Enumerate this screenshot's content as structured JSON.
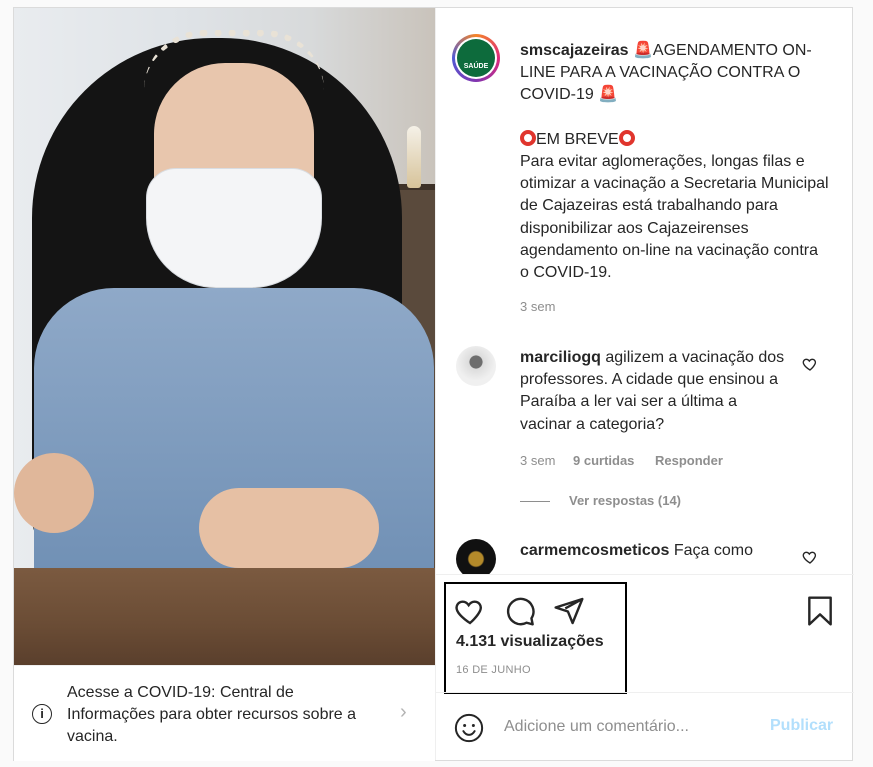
{
  "post": {
    "username": "smscajazeiras",
    "avatar_label": "SAÚDE",
    "caption_line1": "AGENDAMENTO ON-LINE PARA A VACINAÇÃO CONTRA O COVID-19",
    "caption_em_breve": "EM BREVE",
    "caption_body": "Para evitar aglomerações, longas filas e otimizar a vacinação a Secretaria Municipal de Cajazeiras está trabalhando para disponibilizar aos Cajazeirenses agendamento on-line na vacinação contra o COVID-19.",
    "caption_time": "3 sem",
    "views": "4.131 visualizações",
    "date": "16 DE JUNHO"
  },
  "info_bar": {
    "text": "Acesse a COVID-19: Central de Informações para obter recursos sobre a vacina."
  },
  "comments": [
    {
      "username": "marciliogq",
      "text": "agilizem a vacinação dos professores. A cidade que ensinou a Paraíba a ler vai ser a última a vacinar a categoria?",
      "time": "3 sem",
      "likes": "9 curtidas",
      "reply": "Responder",
      "view_replies": "Ver respostas (14)"
    },
    {
      "username": "carmemcosmeticos",
      "text": "Faça como"
    }
  ],
  "add_comment": {
    "placeholder": "Adicione um comentário...",
    "publish": "Publicar"
  },
  "icons": {
    "siren": "🚨",
    "info": "i",
    "chevron": "›"
  }
}
